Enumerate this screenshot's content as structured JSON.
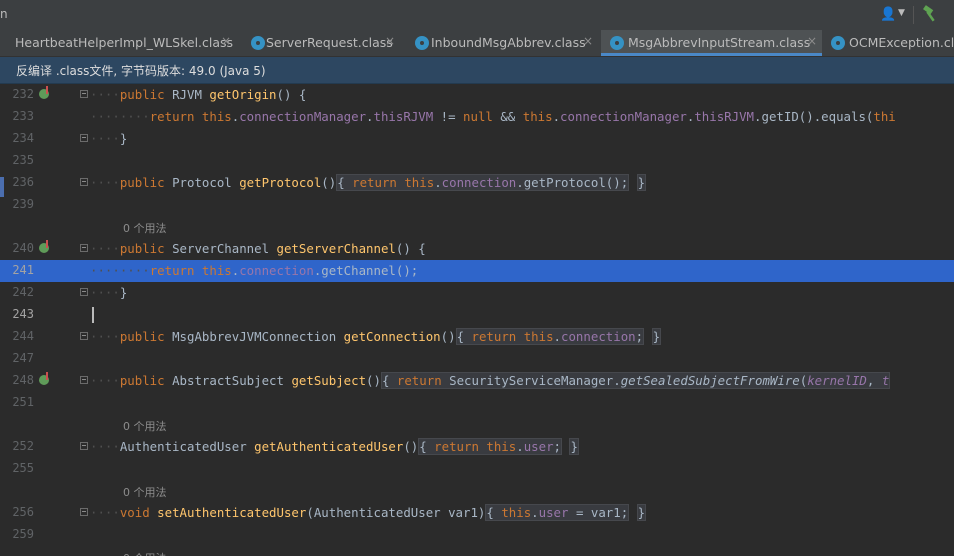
{
  "topbar": {
    "left_stub": "n"
  },
  "tabs": [
    {
      "label": "HeartbeatHelperImpl_WLSkel.class",
      "close": "×"
    },
    {
      "label": "ServerRequest.class",
      "close": "×"
    },
    {
      "label": "InboundMsgAbbrev.class",
      "close": "×"
    },
    {
      "label": "MsgAbbrevInputStream.class",
      "close": "×"
    },
    {
      "label": "OCMException.class",
      "close": ""
    }
  ],
  "banner": {
    "text": "反编译 .class文件, 字节码版本: 49.0 (Java 5)"
  },
  "editor": {
    "hints": {
      "usage": "0 个用法"
    },
    "lines": {
      "l232": "232",
      "l233": "233",
      "l234": "234",
      "l235": "235",
      "l236": "236",
      "l239": "239",
      "l240": "240",
      "l241": "241",
      "l242": "242",
      "l243": "243",
      "l244": "244",
      "l247": "247",
      "l248": "248",
      "l251": "251",
      "l252": "252",
      "l255": "255",
      "l256": "256",
      "l259": "259"
    }
  },
  "colors": {
    "accent": "#4a88c7",
    "keyword": "#cc7832",
    "method": "#ffc66d",
    "field": "#9876aa",
    "selection": "#2f65ca",
    "banner": "#2d4761"
  }
}
